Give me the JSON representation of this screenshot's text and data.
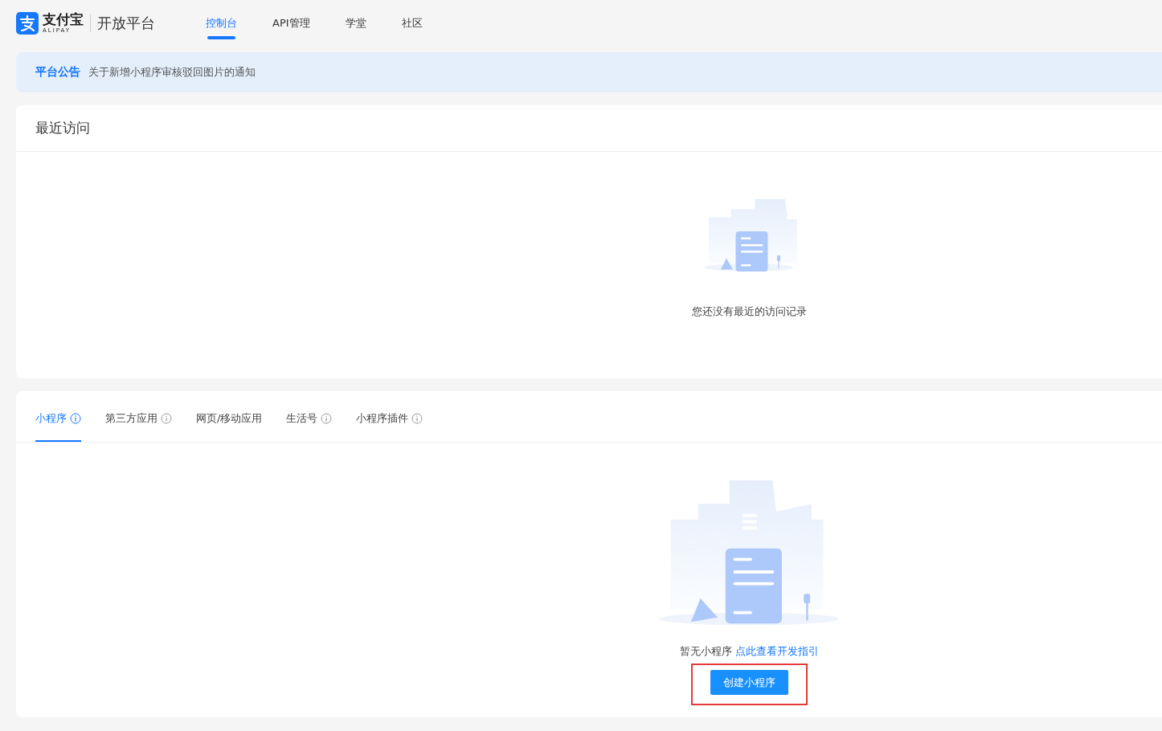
{
  "header": {
    "logo_text": "支付宝",
    "logo_sub": "ALIPAY",
    "platform": "开放平台",
    "nav": [
      {
        "label": "控制台",
        "selected": true
      },
      {
        "label": "API管理",
        "selected": false
      },
      {
        "label": "学堂",
        "selected": false
      },
      {
        "label": "社区",
        "selected": false
      }
    ]
  },
  "notice": {
    "label": "平台公告",
    "text": "关于新增小程序审核驳回图片的通知"
  },
  "recent": {
    "title": "最近访问",
    "empty_text": "您还没有最近的访问记录"
  },
  "apps": {
    "tabs": [
      {
        "label": "小程序",
        "info": true,
        "selected": true
      },
      {
        "label": "第三方应用",
        "info": true,
        "selected": false
      },
      {
        "label": "网页/移动应用",
        "info": false,
        "selected": false
      },
      {
        "label": "生活号",
        "info": true,
        "selected": false
      },
      {
        "label": "小程序插件",
        "info": true,
        "selected": false
      }
    ],
    "empty_text": "暂无小程序",
    "guide_link": "点此查看开发指引",
    "create_button": {
      "label": "创建小程序",
      "highlighted": true
    }
  }
}
